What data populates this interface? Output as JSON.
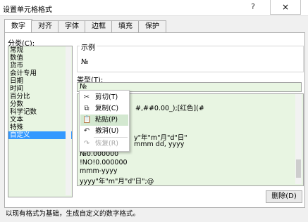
{
  "window": {
    "title": "设置单元格格式",
    "help_glyph": "?",
    "close_glyph": "×"
  },
  "tabs": [
    "数字",
    "对齐",
    "字体",
    "边框",
    "填充",
    "保护"
  ],
  "category": {
    "label": "分类(C):",
    "items": [
      "常规",
      "数值",
      "货币",
      "会计专用",
      "日期",
      "时间",
      "百分比",
      "分数",
      "科学记数",
      "文本",
      "特殊",
      "自定义"
    ],
    "selected": "自定义"
  },
  "sample": {
    "label": "示例",
    "value": "№"
  },
  "type": {
    "label": "类型(T):",
    "input_value": "№",
    "items_visible_right": [
      "#,##0.00_);[红色](#",
      "y\"年\"m\"月\"d\"日\"",
      "mmm dd, yyyy"
    ],
    "items_left": [
      "№0.000000",
      "!NO!0.000000",
      "mmm-yyyy",
      "yyyy\"年\"m\"月\"d\"日\";@"
    ]
  },
  "buttons": {
    "delete": "删除(D)"
  },
  "description": "以现有格式为基础，生成自定义的数字格式。",
  "context_menu": {
    "items": [
      {
        "icon": "scissors-icon",
        "glyph": "✂",
        "label": "剪切(T)",
        "enabled": true
      },
      {
        "icon": "copy-icon",
        "glyph": "⧉",
        "label": "复制(C)",
        "enabled": true
      },
      {
        "icon": "paste-icon",
        "glyph": "📋",
        "label": "粘贴(P)",
        "enabled": true,
        "highlighted": true
      },
      {
        "icon": "undo-icon",
        "glyph": "↶",
        "label": "撤消(U)",
        "enabled": true
      },
      {
        "icon": "redo-icon",
        "glyph": "↷",
        "label": "恢复(R)",
        "enabled": false
      }
    ]
  },
  "colors": {
    "list_bg": "#e8f5e2",
    "selection": "#3399ff",
    "menu_hover": "#d3e8d0"
  }
}
